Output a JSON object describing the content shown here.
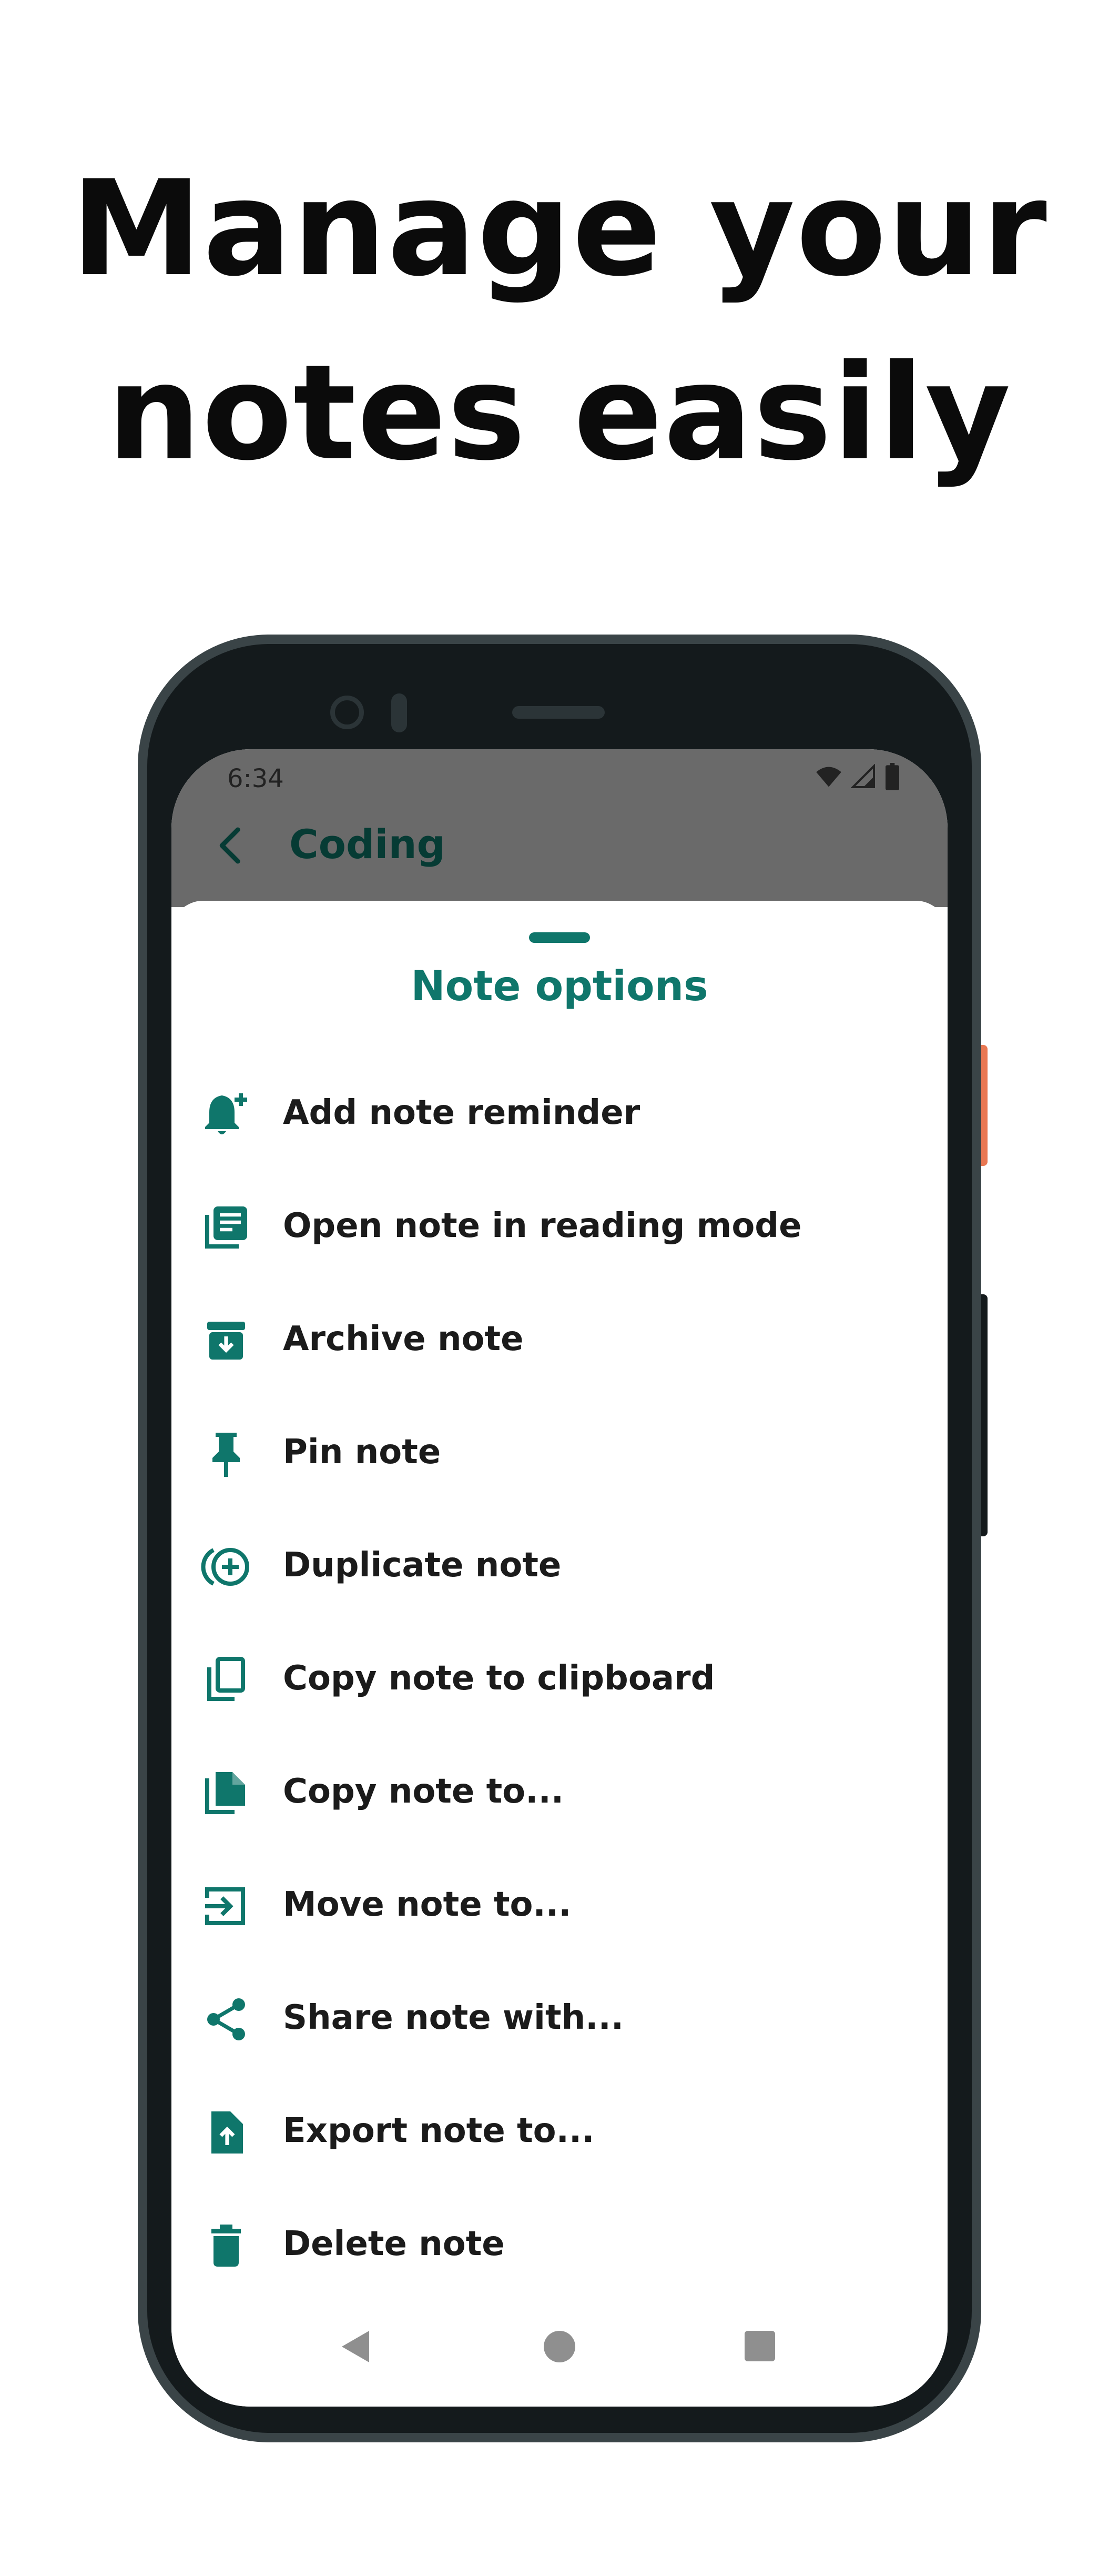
{
  "headline": {
    "line1": "Manage your",
    "line2": "notes easily"
  },
  "status_bar": {
    "time": "6:34",
    "icons": [
      "wifi-icon",
      "signal-icon",
      "battery-icon"
    ]
  },
  "app_bar": {
    "back_icon": "arrow-back-icon",
    "title": "Coding"
  },
  "sheet": {
    "title": "Note options",
    "items": [
      {
        "label": "Add note reminder",
        "icon": "bell-plus-icon"
      },
      {
        "label": "Open note in reading mode",
        "icon": "reading-mode-icon"
      },
      {
        "label": "Archive note",
        "icon": "archive-icon"
      },
      {
        "label": "Pin note",
        "icon": "pin-icon"
      },
      {
        "label": "Duplicate note",
        "icon": "duplicate-icon"
      },
      {
        "label": "Copy note to clipboard",
        "icon": "copy-clipboard-icon"
      },
      {
        "label": "Copy note to...",
        "icon": "copy-file-icon"
      },
      {
        "label": "Move note to...",
        "icon": "move-icon"
      },
      {
        "label": "Share note with...",
        "icon": "share-icon"
      },
      {
        "label": "Export note to...",
        "icon": "export-icon"
      },
      {
        "label": "Delete note",
        "icon": "trash-icon"
      }
    ]
  },
  "nav_bar": {
    "icons": [
      "nav-back-icon",
      "nav-home-icon",
      "nav-recents-icon"
    ]
  },
  "colors": {
    "accent": "#0f766b",
    "scrim": "#6a6a6a",
    "phone_frame": "#3a4447",
    "side_button": "#e97752"
  }
}
